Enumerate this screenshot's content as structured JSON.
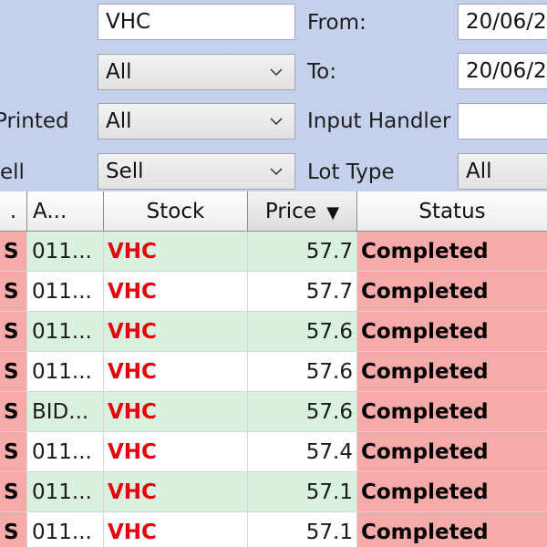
{
  "filters": {
    "symbol_value": "VHC",
    "from_label": "From:",
    "from_value": "20/06/2",
    "to_label": "To:",
    "to_value": "20/06/2",
    "row2_combo_value": "All",
    "printed_label": "Printed",
    "printed_value": "All",
    "input_handler_label": "Input Handler",
    "input_handler_value": "",
    "side_label": "ell",
    "side_value": "Sell",
    "lot_type_label": "Lot Type",
    "lot_type_value": "All"
  },
  "grid": {
    "columns": {
      "side": ".",
      "account": "A...",
      "stock": "Stock",
      "price": "Price",
      "price_sort_icon": "sort-descending-icon",
      "price_sort_glyph": "▼",
      "status": "Status"
    },
    "rows": [
      {
        "side": "S",
        "account": "011...",
        "stock": "VHC",
        "price": "57.7",
        "status": "Completed"
      },
      {
        "side": "S",
        "account": "011...",
        "stock": "VHC",
        "price": "57.7",
        "status": "Completed"
      },
      {
        "side": "S",
        "account": "011...",
        "stock": "VHC",
        "price": "57.6",
        "status": "Completed"
      },
      {
        "side": "S",
        "account": "011...",
        "stock": "VHC",
        "price": "57.6",
        "status": "Completed"
      },
      {
        "side": "S",
        "account": "BID...",
        "stock": "VHC",
        "price": "57.6",
        "status": "Completed"
      },
      {
        "side": "S",
        "account": "011...",
        "stock": "VHC",
        "price": "57.4",
        "status": "Completed"
      },
      {
        "side": "S",
        "account": "011...",
        "stock": "VHC",
        "price": "57.1",
        "status": "Completed"
      },
      {
        "side": "S",
        "account": "011...",
        "stock": "VHC",
        "price": "57.1",
        "status": "Completed"
      }
    ]
  },
  "colors": {
    "panel_bg": "#c5d0ec",
    "sell_status_bg": "#f6aaa9",
    "alt_row_bg": "#d9f1de",
    "stock_text": "#e8000b"
  }
}
